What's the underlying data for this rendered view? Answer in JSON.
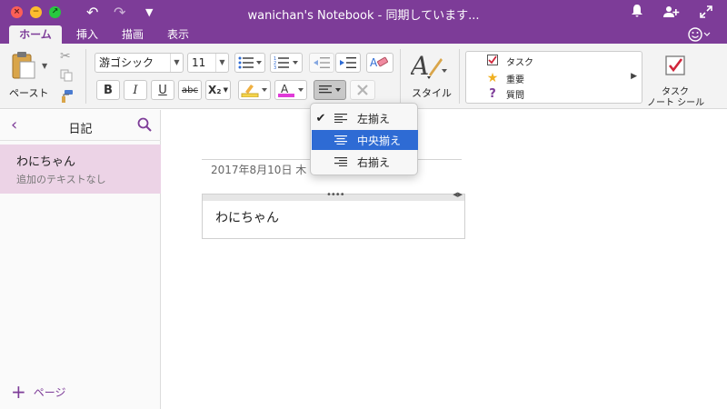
{
  "window": {
    "title": "wanichan's Notebook - 同期しています..."
  },
  "tabs": [
    {
      "label": "ホーム",
      "active": true
    },
    {
      "label": "挿入",
      "active": false
    },
    {
      "label": "描画",
      "active": false
    },
    {
      "label": "表示",
      "active": false
    }
  ],
  "ribbon": {
    "paste_label": "ペースト",
    "font_name": "游ゴシック",
    "font_size": "11",
    "bold": "B",
    "italic": "I",
    "underline": "U",
    "strike": "abc",
    "subscript": "X₂",
    "style_label": "スタイル",
    "tags": [
      {
        "label": "タスク",
        "icon": "checkbox-icon"
      },
      {
        "label": "重要",
        "icon": "star-icon"
      },
      {
        "label": "質問",
        "icon": "question-icon"
      }
    ],
    "task_note_label_1": "タスク",
    "task_note_label_2": "ノート シール",
    "colors": {
      "highlight": "#f5d44a",
      "font_color": "#e03bd8",
      "accent": "#7d3c98"
    }
  },
  "sidebar": {
    "title": "日記",
    "pages": [
      {
        "title": "わにちゃん",
        "subtitle": "追加のテキストなし"
      }
    ],
    "add_page_label": "ページ"
  },
  "canvas": {
    "date": "2017年8月10日 木",
    "note_text": "わにちゃん"
  },
  "align_menu": {
    "items": [
      {
        "label": "左揃え",
        "checked": true,
        "selected": false
      },
      {
        "label": "中央揃え",
        "checked": false,
        "selected": true
      },
      {
        "label": "右揃え",
        "checked": false,
        "selected": false
      }
    ]
  }
}
